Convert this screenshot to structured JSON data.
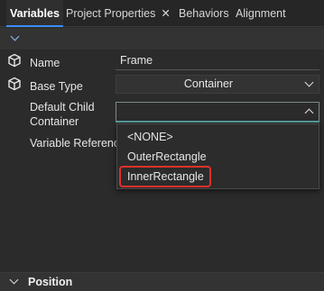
{
  "tabs": [
    {
      "label": "Variables",
      "active": true
    },
    {
      "label": "Project Properties",
      "closable": true,
      "close_glyph": "✕"
    },
    {
      "label": "Behaviors"
    },
    {
      "label": "Alignment"
    }
  ],
  "properties": {
    "name": {
      "label": "Name",
      "value": "Frame",
      "icon": "cube-icon"
    },
    "base_type": {
      "label": "Base Type",
      "value": "Container",
      "icon": "cube-icon"
    },
    "default_child_container": {
      "label_line1": "Default Child",
      "label_line2": "Container",
      "value": ""
    },
    "variable_reference": {
      "label": "Variable Reference"
    }
  },
  "dropdown": {
    "options": [
      "<NONE>",
      "OuterRectangle",
      "InnerRectangle"
    ],
    "highlighted": "InnerRectangle"
  },
  "position_section": {
    "label": "Position"
  },
  "colors": {
    "accent": "#3c8cff",
    "highlight": "#e0302c"
  }
}
